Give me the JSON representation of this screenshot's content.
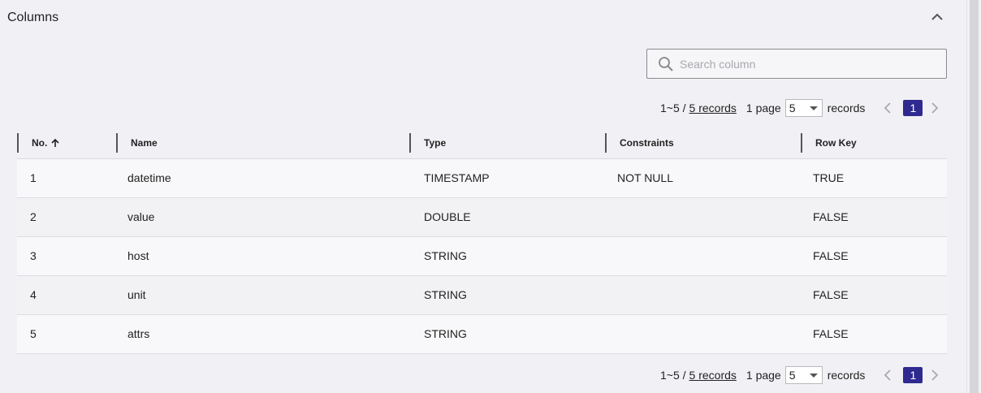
{
  "section": {
    "title": "Columns"
  },
  "search": {
    "placeholder": "Search column",
    "value": ""
  },
  "pager": {
    "range": "1~5 /",
    "records_link": "5 records",
    "page_label": "1 page",
    "page_size": "5",
    "records_label": "records",
    "current_page": "1"
  },
  "table": {
    "headers": [
      "No.",
      "Name",
      "Type",
      "Constraints",
      "Row Key"
    ],
    "rows": [
      [
        "1",
        "datetime",
        "TIMESTAMP",
        "NOT NULL",
        "TRUE"
      ],
      [
        "2",
        "value",
        "DOUBLE",
        "",
        "FALSE"
      ],
      [
        "3",
        "host",
        "STRING",
        "",
        "FALSE"
      ],
      [
        "4",
        "unit",
        "STRING",
        "",
        "FALSE"
      ],
      [
        "5",
        "attrs",
        "STRING",
        "",
        "FALSE"
      ]
    ]
  },
  "colors": {
    "accent": "#2e2a8f",
    "background": "#f1f0f4"
  },
  "icons": {
    "collapse": "chevron-up-icon",
    "search": "search-icon",
    "sort": "arrow-up-icon",
    "prev": "chevron-left-icon",
    "next": "chevron-right-icon"
  }
}
